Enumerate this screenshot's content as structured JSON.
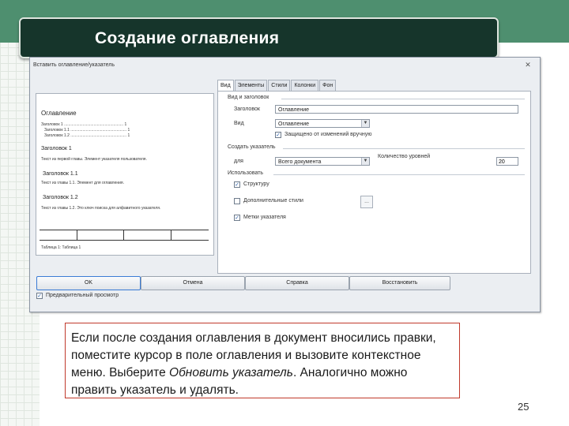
{
  "slide": {
    "title": "Создание оглавления",
    "page_number": "25",
    "caption": {
      "part1": "Если после создания оглавления в документ вносились правки, поместите курсор в поле оглавления и вызовите контекстное меню. Выберите ",
      "italic": "Обновить указатель",
      "part2": ". Аналогично можно править указатель и удалять."
    }
  },
  "dialog": {
    "title": "Вставить оглавление/указатель",
    "close_glyph": "✕",
    "tabs": [
      "Вид",
      "Элементы",
      "Стили",
      "Колонки",
      "Фон"
    ],
    "type_title_section": "Вид и заголовок",
    "title_label": "Заголовок",
    "title_value": "Оглавление",
    "type_label": "Вид",
    "type_value": "Оглавление",
    "protect_label": "Защищено от изменений вручную",
    "create_section": "Создать указатель",
    "for_label": "для",
    "for_value": "Всего документа",
    "level_label": "Количество уровней",
    "level_value": "20",
    "create_from_section": "Использовать",
    "outline_label": "Структуру",
    "additional_label": "Дополнительные стили",
    "additional_button": "...",
    "marks_label": "Метки указателя",
    "preview_checkbox_label": "Предварительный просмотр",
    "buttons": {
      "ok": "OK",
      "cancel": "Отмена",
      "help": "Справка",
      "reset": "Восстановить"
    },
    "preview": {
      "heading": "Оглавление",
      "toc": [
        "Заголовок 1 ...................................................... 1",
        "Заголовок 1.1 ................................................... 1",
        "Заголовок 1.2 ................................................... 1"
      ],
      "h1": "Заголовок 1",
      "p1": "Текст из первой главы. Элемент указателя пользователя.",
      "h11": "Заголовок 1.1",
      "p11": "Текст из главы 1.1. Элемент для оглавления.",
      "h12": "Заголовок 1.2",
      "p12": "Текст из главы 1.2. Это ключ поиска для алфавитного указателя.",
      "table_caption": "Таблица 1: Таблица 1"
    }
  }
}
